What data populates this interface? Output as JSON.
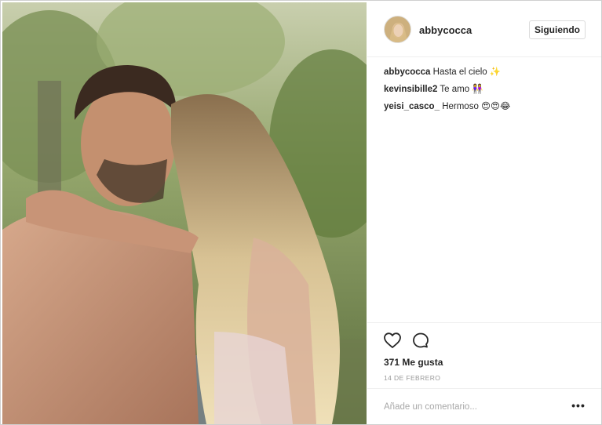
{
  "post": {
    "username": "abbycocca",
    "follow_label": "Siguiendo",
    "comments": [
      {
        "user": "abbycocca",
        "text": "Hasta el cielo ✨"
      },
      {
        "user": "kevinsibille2",
        "text": "Te amo 👭"
      },
      {
        "user": "yeisi_casco_",
        "text": "Hermoso 😍😍😂"
      }
    ],
    "likes_text": "371 Me gusta",
    "date_text": "14 DE FEBRERO",
    "comment_placeholder": "Añade un comentario...",
    "more_label": "•••"
  },
  "icons": {
    "like": "heart-icon",
    "comment": "comment-bubble-icon",
    "more": "more-options-icon"
  },
  "colors": {
    "text": "#262626",
    "muted": "#999999",
    "divider": "#efefef",
    "button_border": "#dbdbdb"
  }
}
